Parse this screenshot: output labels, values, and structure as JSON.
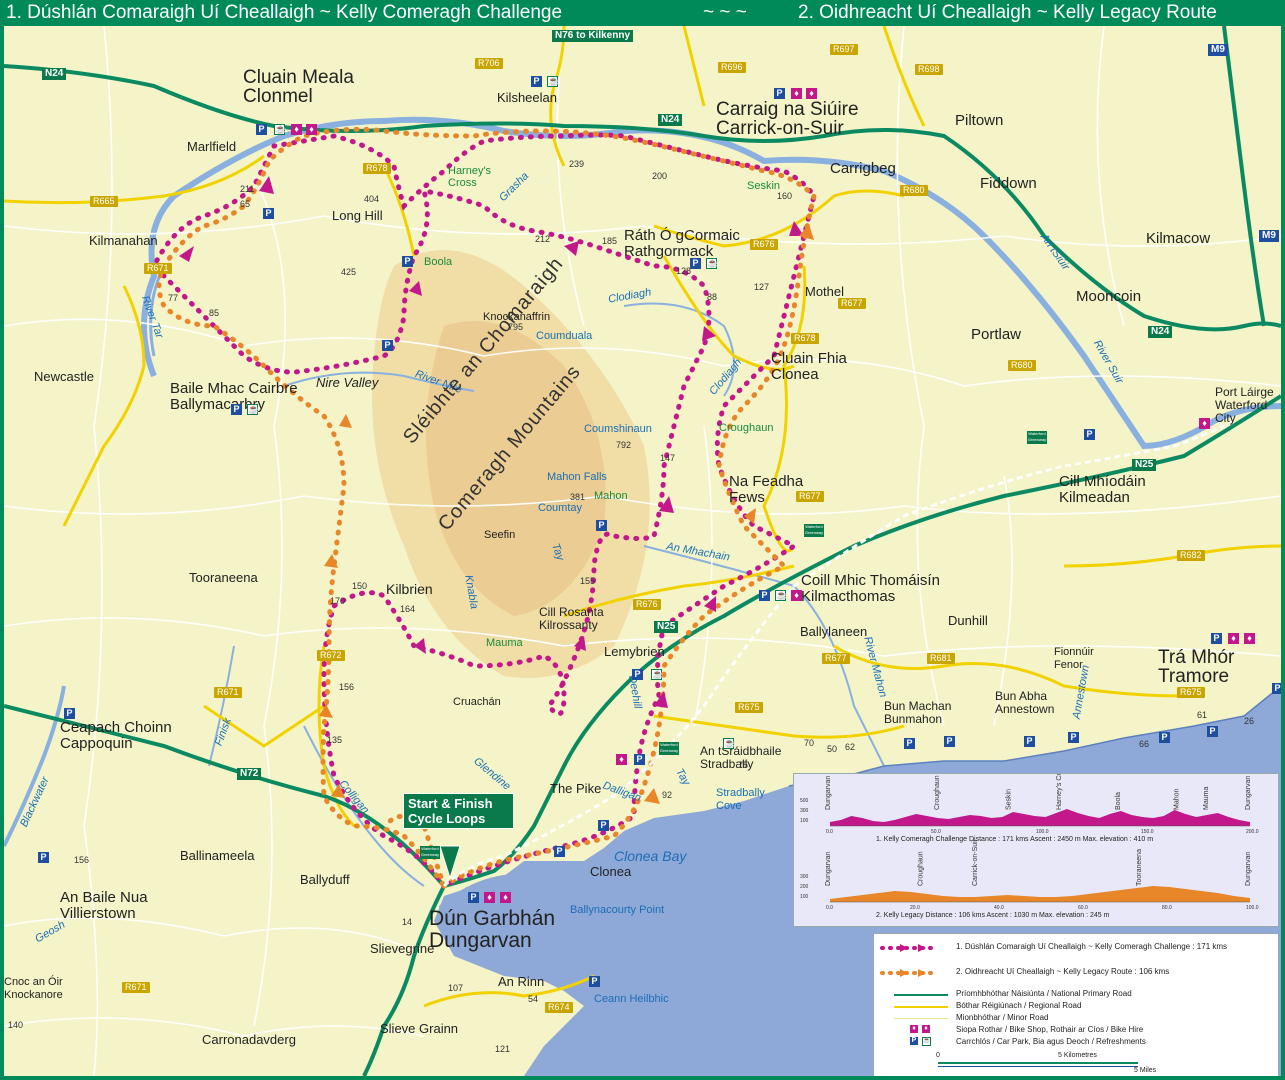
{
  "header": {
    "left_title": "1. Dúshlán Comaraigh Uí Cheallaigh ~ Kelly Comeragh Challenge",
    "separator": "~ ~ ~",
    "right_title": "2. Oidhreacht Uí Cheallaigh ~ Kelly Legacy Route"
  },
  "road_shields": {
    "n76": "N76 to Kilkenny",
    "n24_west": "N24",
    "n24_mid": "N24",
    "n24_east": "N24",
    "n25_east": "N25",
    "n25_mid": "N25",
    "n72": "N72",
    "m9_top": "M9",
    "m9_right": "M9",
    "r706": "R706",
    "r696": "R696",
    "r697": "R697",
    "r698": "R698",
    "r665": "R665",
    "r671_nw": "R671",
    "r671_w": "R671",
    "r671_sw": "R671",
    "r678_n": "R678",
    "r678_mid": "R678",
    "r680_n": "R680",
    "r680_e": "R680",
    "r676_n": "R676",
    "r676_s": "R676",
    "r677_n": "R677",
    "r677_mid": "R677",
    "r677_s": "R677",
    "r672": "R672",
    "r681": "R681",
    "r675_w": "R675",
    "r675_e": "R675",
    "r674": "R674",
    "r682": "R682"
  },
  "places": {
    "clonmel_ga": "Cluain Meala",
    "clonmel_en": "Clonmel",
    "carrick_ga": "Carraig na Siúire",
    "carrick_en": "Carrick-on-Suir",
    "kilsheelan": "Kilsheelan",
    "piltown": "Piltown",
    "fiddown": "Fiddown",
    "kilmacow": "Kilmacow",
    "mooncoin": "Mooncoin",
    "portlaw": "Portlaw",
    "marlfield": "Marlfield",
    "long_hill": "Long Hill",
    "kilmanahan": "Kilmanahan",
    "carrigbeg": "Carrigbeg",
    "seskin": "Seskin",
    "harneys_cross": "Harney's Cross",
    "boola": "Boola",
    "grasha": "Grasha",
    "rathgormack_ga": "Ráth Ó gCormaic",
    "rathgormack_en": "Rathgormack",
    "mothel": "Mothel",
    "clonea_ga": "Cluain Fhia",
    "clonea_en": "Clonea",
    "newcastle": "Newcastle",
    "ballymacarbry_ga": "Baile Mhac Cairbre",
    "ballymacarbry_en": "Ballymacarbry",
    "nire_valley": "Nire Valley",
    "knockanaffrin": "Knockanaffrin",
    "coumduala": "Coumduala",
    "coumshinaun": "Coumshinaun",
    "croughaun": "Croughaun",
    "fews_ga": "Na Feadha",
    "fews_en": "Fews",
    "waterford_ga": "Port Láirge",
    "waterford_en1": "Waterford",
    "waterford_en2": "City",
    "kilmeadan_ga": "Cill Mhíodáin",
    "kilmeadan_en": "Kilmeadan",
    "mahon_falls": "Mahon Falls",
    "mahon": "Mahon",
    "countay": "Coumtay",
    "seefin": "Seefin",
    "tooraneena": "Tooraneena",
    "kilbrien": "Kilbrien",
    "kilrossanty_ga": "Cill Rosanta",
    "kilrossanty_en": "Kilrossanty",
    "kilmac_ga": "Coill Mhic Thomáisín",
    "kilmac_en": "Kilmacthomas",
    "ballylaneen": "Ballylaneen",
    "dunhill": "Dunhill",
    "fenor_ga": "Fionnúir",
    "fenor_en": "Fenor",
    "tramore_ga": "Trá Mhór",
    "tramore_en": "Tramore",
    "lemybrien": "Lemybrien",
    "mauma": "Mauma",
    "cruachan": "Cruachán",
    "bunmahon_ga": "Bun Machan",
    "bunmahon_en": "Bunmahon",
    "annestown_ga": "Bun Abha",
    "annestown_en": "Annestown",
    "annestown_river": "Annestown",
    "cappoquin_ga": "Ceapach Choinn",
    "cappoquin_en": "Cappoquin",
    "stradbally_ga": "An tSráidbhaile",
    "stradbally_en": "Stradbally",
    "stradbally_cove1": "Stradbally",
    "stradbally_cove2": "Cove",
    "the_pike": "The Pike",
    "clonea_bay": "Clonea Bay",
    "clonea": "Clonea",
    "ballinameela": "Ballinameela",
    "ballyduff": "Ballyduff",
    "dungarvan_ga": "Dún Garbhán",
    "dungarvan_en": "Dungarvan",
    "ballynacourty": "Ballynacourty Point",
    "villierstown_ga": "An Baile Nua",
    "villierstown_en": "Villierstown",
    "slievegrine": "Slievegrine",
    "an_rinn": "An Rinn",
    "helvick": "Ceann Heilbhic",
    "knockanore_ga": "Cnoc an Óir",
    "knockanore_en": "Knockanore",
    "slieve_grainn": "Slieve Grainn",
    "carronadavderg": "Carronadavderg"
  },
  "water": {
    "river_suir": "River Suir",
    "an_tsiuir": "An tSiúir",
    "river_tar": "River Tar",
    "clodiagh_n": "Clodiagh",
    "clodiagh_e": "Clodiagh",
    "river_nire": "River Nire",
    "river_mahon": "River Mahon",
    "an_mhachain": "An Mhachain",
    "tay": "Tay",
    "finisk": "Finisk",
    "colligan": "Colligan",
    "blackwater": "Blackwater",
    "glendine": "Glendine",
    "dalligan": "Dalligan",
    "deehill": "Deehill",
    "tay2": "Tay",
    "geosh": "Geosh",
    "knabla": "Knabla"
  },
  "mountains": {
    "line1": "Sléibhte an Chomaraigh",
    "line2": "Comeragh Mountains"
  },
  "spot_heights": {
    "h211": "211",
    "h65": "65",
    "h404": "404",
    "h425": "425",
    "h239": "239",
    "h200": "200",
    "h212": "212",
    "h185": "185",
    "h160": "160",
    "h128": "128",
    "h127": "127",
    "h88": "88",
    "h77": "77",
    "h85": "85",
    "h795": "795",
    "h792": "792",
    "h147": "147",
    "h381": "381",
    "h155": "155",
    "h150": "150",
    "h170": "170",
    "h164": "164",
    "h156": "156",
    "h135": "135",
    "h92": "92",
    "h75": "75",
    "h70": "70",
    "h50": "50",
    "h62": "62",
    "h66": "66",
    "h61": "61",
    "h26": "26",
    "h14": "14",
    "h107": "107",
    "h54": "54",
    "h121": "121",
    "h140": "140",
    "h156w": "156"
  },
  "start": {
    "line1": "Start & Finish",
    "line2": "Cycle Loops"
  },
  "badges": {
    "greenway": "Waterford Greenway"
  },
  "icons": {
    "parking": "P",
    "cafe": "☕",
    "bike_shop": "♦"
  },
  "elevation": {
    "profile1": {
      "labels": [
        "Dungarvan",
        "Croughaun",
        "Seskin",
        "Harney's Cross",
        "Boola",
        "Mahon",
        "Mauma",
        "Dungarvan"
      ],
      "y_ticks": [
        "500",
        "300",
        "100"
      ],
      "x_ticks": [
        "0.0",
        "50.0",
        "100.0",
        "150.0",
        "200.0"
      ],
      "caption": "1. Kelly Comeragh Challenge    Distance : 171 kms    Ascent : 2450 m    Max. elevation : 410 m"
    },
    "profile2": {
      "labels": [
        "Dungarvan",
        "Croughaun",
        "Carrick-on-Suir",
        "Tooraneena",
        "Dungarvan"
      ],
      "y_ticks": [
        "300",
        "200",
        "100"
      ],
      "x_ticks": [
        "0.0",
        "20.0",
        "40.0",
        "60.0",
        "80.0",
        "100.0"
      ],
      "caption": "2. Kelly Legacy    Distance : 106 kms    Ascent : 1030 m    Max. elevation : 245 m"
    }
  },
  "legend": {
    "route1": "1. Dúshlán Comaraigh Uí Cheallaigh ~ Kelly Comeragh Challenge : 171 kms",
    "route2": "2. Oidhreacht Uí Cheallaigh ~ Kelly Legacy Route : 106 kms",
    "national": "Príomhbhóthar Náisiúnta / National Primary Road",
    "regional": "Bóthar Réigiúnach / Regional Road",
    "minor": "Mionbhóthar / Minor Road",
    "bike": "Siopa Rothar / Bike Shop, Rothair ar Cíos / Bike Hire",
    "parking": "Carrchlós / Car Park, Bia agus Deoch / Refreshments",
    "scale_zero": "0",
    "scale_km": "5 Kilometres",
    "scale_mi": "5 Miles"
  },
  "colors": {
    "frame": "#008a5a",
    "land": "#f4f4c8",
    "sea": "#8ea8d8",
    "national": "#0b8a62",
    "regional": "#f1d200",
    "route1": "#c2188c",
    "route2": "#e8862a",
    "river": "#8ab0e0"
  }
}
